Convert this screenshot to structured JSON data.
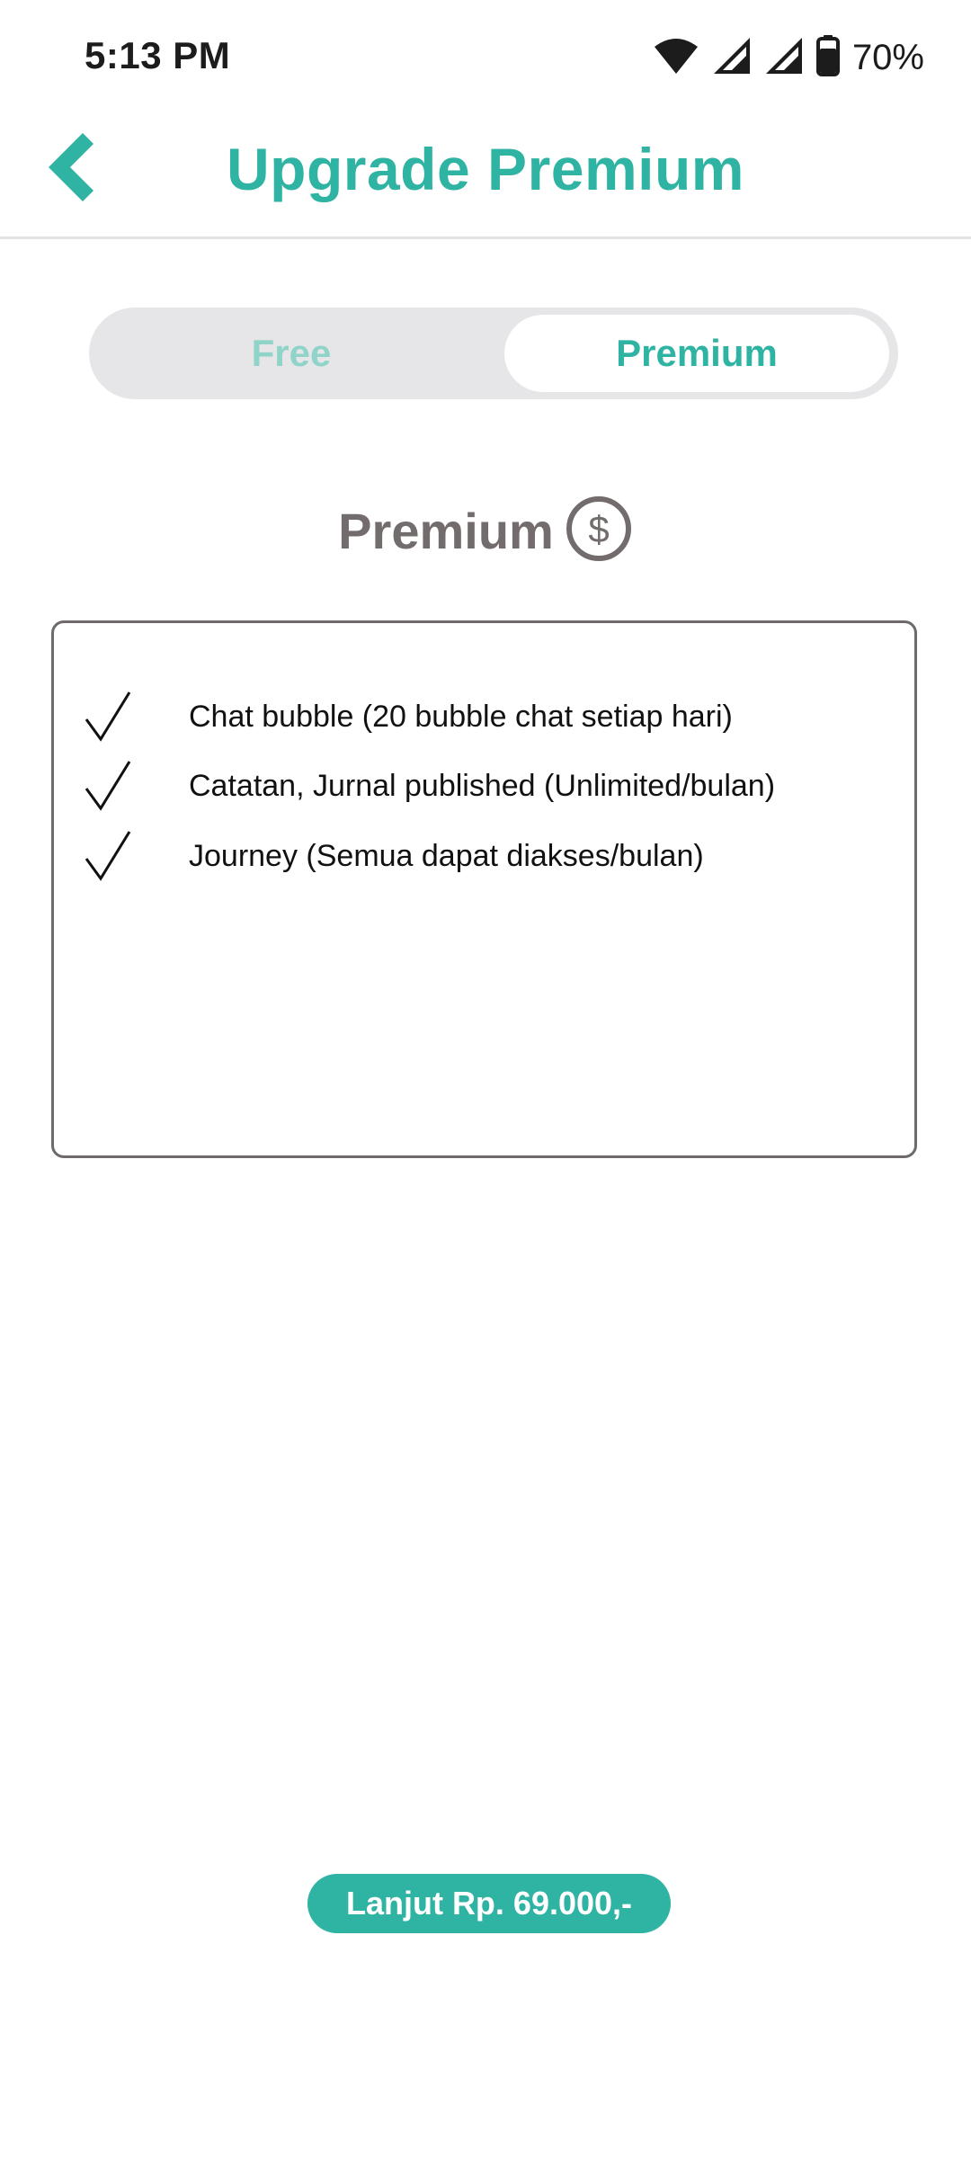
{
  "status_bar": {
    "time": "5:13 PM",
    "battery_percent": "70%",
    "icons": [
      "wifi-icon",
      "signal-icon",
      "signal-icon",
      "battery-icon"
    ]
  },
  "header": {
    "title": "Upgrade Premium",
    "back_icon": "chevron-left-icon"
  },
  "toggle": {
    "options": [
      "Free",
      "Premium"
    ],
    "selected": "Premium"
  },
  "plan": {
    "title": "Premium",
    "icon": "dollar-circle-icon",
    "features": [
      "Chat bubble (20 bubble chat setiap hari)",
      "Catatan, Jurnal published (Unlimited/bulan)",
      "Journey (Semua dapat diakses/bulan)"
    ]
  },
  "cta": {
    "label": "Lanjut Rp. 69.000,-"
  },
  "colors": {
    "accent": "#2fb3a3",
    "accent_light": "#8fd3c9",
    "toggle_bg": "#e6e6e8",
    "heading_gray": "#736c6c"
  }
}
